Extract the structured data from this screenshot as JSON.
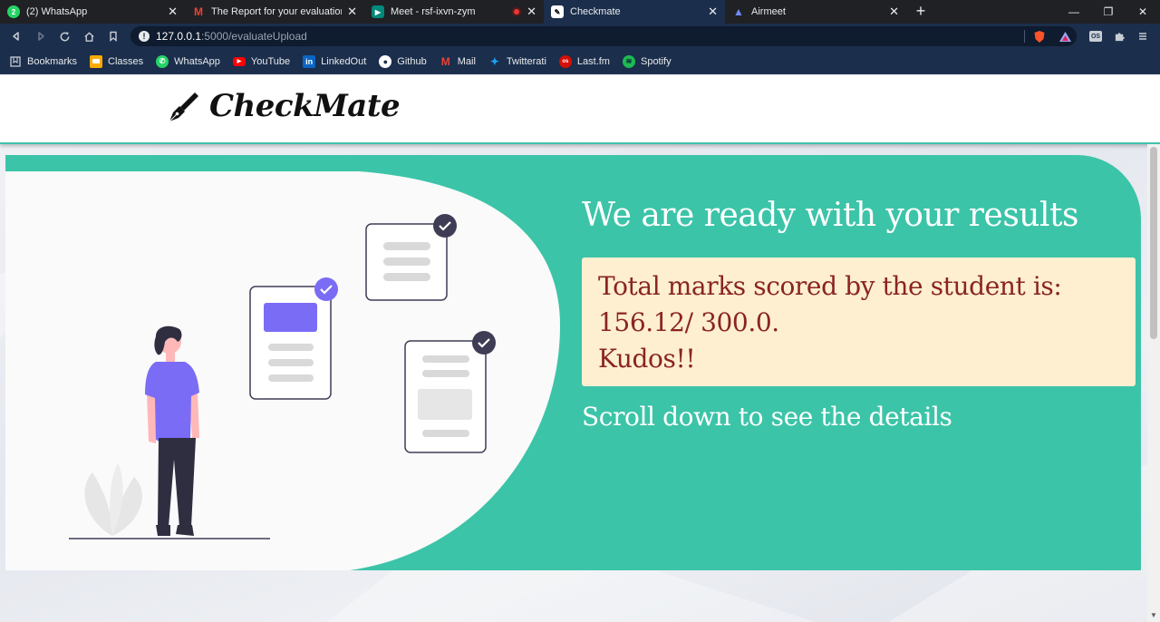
{
  "tabs": [
    {
      "title": "(2) WhatsApp",
      "icon": "whatsapp-icon",
      "color": "#25d366",
      "glyph": "2"
    },
    {
      "title": "The Report for your evaluation is h",
      "icon": "gmail-icon",
      "color": "#ea4335",
      "glyph": "M"
    },
    {
      "title": "Meet - rsf-ixvn-zym",
      "icon": "meet-icon",
      "color": "#00897b",
      "glyph": "▶"
    },
    {
      "title": "Checkmate",
      "icon": "checkmate-icon",
      "color": "#000000",
      "glyph": "✎"
    },
    {
      "title": "Airmeet",
      "icon": "airmeet-icon",
      "color": "#6c5ce7",
      "glyph": "▲"
    }
  ],
  "browser": {
    "url_host": "127.0.0.1",
    "url_path": ":5000/evaluateUpload"
  },
  "bookmarks": [
    {
      "label": "Bookmarks",
      "icon": "bookmarks-icon",
      "color": "#1b2e4b",
      "glyph": "☐"
    },
    {
      "label": "Classes",
      "icon": "classroom-icon",
      "color": "#f9ab00",
      "glyph": "▪"
    },
    {
      "label": "WhatsApp",
      "icon": "whatsapp-icon",
      "color": "#25d366",
      "glyph": "✆"
    },
    {
      "label": "YouTube",
      "icon": "youtube-icon",
      "color": "#ff0000",
      "glyph": "▶"
    },
    {
      "label": "LinkedOut",
      "icon": "linkedin-icon",
      "color": "#0a66c2",
      "glyph": "in"
    },
    {
      "label": "Github",
      "icon": "github-icon",
      "color": "#1b2e4b",
      "glyph": "●"
    },
    {
      "label": "Mail",
      "icon": "gmail-icon",
      "color": "#1b2e4b",
      "glyph": "M"
    },
    {
      "label": "Twitterati",
      "icon": "twitter-icon",
      "color": "#1da1f2",
      "glyph": "✦"
    },
    {
      "label": "Last.fm",
      "icon": "lastfm-icon",
      "color": "#d51007",
      "glyph": "os"
    },
    {
      "label": "Spotify",
      "icon": "spotify-icon",
      "color": "#1db954",
      "glyph": "≋"
    }
  ],
  "site": {
    "brand": "CheckMate"
  },
  "results": {
    "heading": "We are ready with your results",
    "score_line1": "Total marks scored by the student is:",
    "score_line2": "156.12/ 300.0.",
    "score_line3": "Kudos!!",
    "hint": "Scroll down to see the details"
  },
  "colors": {
    "accent": "#3cc4a8",
    "score_bg": "#fdefcf",
    "score_text": "#8a2424",
    "illustration_purple": "#7b6cf6"
  }
}
